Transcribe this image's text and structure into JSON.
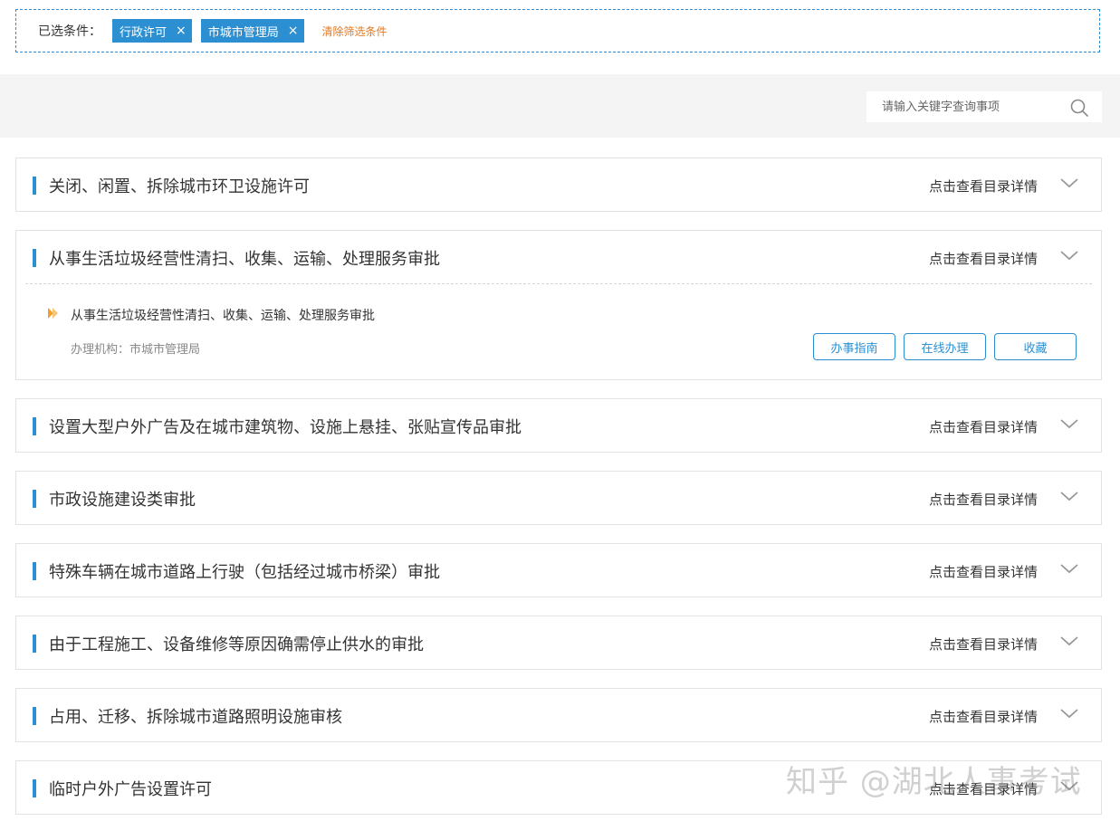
{
  "filter": {
    "label": "已选条件：",
    "tags": [
      {
        "label": "行政许可"
      },
      {
        "label": "市城市管理局"
      }
    ],
    "close_glyph": "×",
    "clear_label": "清除筛选条件"
  },
  "search": {
    "placeholder": "请输入关键字查询事项"
  },
  "items": [
    {
      "title": "关闭、闲置、拆除城市环卫设施许可",
      "detail": "点击查看目录详情"
    },
    {
      "title": "从事生活垃圾经营性清扫、收集、运输、处理服务审批",
      "detail": "点击查看目录详情",
      "sub": {
        "title": "从事生活垃圾经营性清扫、收集、运输、处理服务审批",
        "org": "办理机构：市城市管理局",
        "btn_guide": "办事指南",
        "btn_online": "在线办理",
        "btn_favorite": "收藏"
      }
    },
    {
      "title": "设置大型户外广告及在城市建筑物、设施上悬挂、张贴宣传品审批",
      "detail": "点击查看目录详情"
    },
    {
      "title": "市政设施建设类审批",
      "detail": "点击查看目录详情"
    },
    {
      "title": "特殊车辆在城市道路上行驶（包括经过城市桥梁）审批",
      "detail": "点击查看目录详情"
    },
    {
      "title": "由于工程施工、设备维修等原因确需停止供水的审批",
      "detail": "点击查看目录详情"
    },
    {
      "title": "占用、迁移、拆除城市道路照明设施审核",
      "detail": "点击查看目录详情"
    },
    {
      "title": "临时户外广告设置许可",
      "detail": "点击查看目录详情"
    }
  ],
  "watermark": "知乎 @湖北人事考试",
  "colors": {
    "accent": "#2b8fd1",
    "clear_link": "#e07a22",
    "arrow": "#f0a030"
  }
}
